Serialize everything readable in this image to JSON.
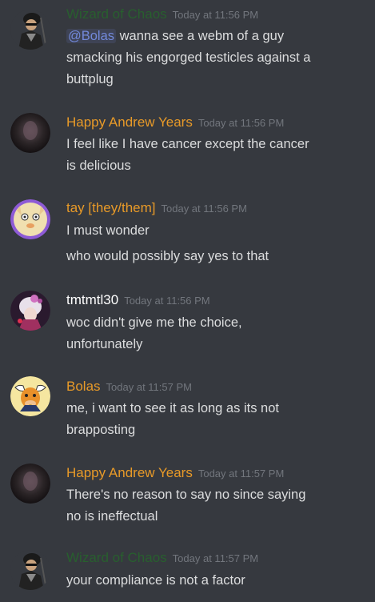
{
  "colors": {
    "background": "#36393f",
    "name_green": "#285f2e",
    "name_orange": "#e89a28",
    "name_white": "#ffffff",
    "timestamp": "#72767d",
    "text": "#dcddde",
    "mention": "#7289da"
  },
  "messages": [
    {
      "author": "Wizard of Chaos",
      "timestamp": "Today at 11:56 PM",
      "avatar": "wizard-avatar",
      "mention": "@Bolas",
      "lines": [
        "wanna see a webm of a guy",
        "smacking his engorged testicles against a",
        "buttplug"
      ]
    },
    {
      "author": "Happy Andrew Years",
      "timestamp": "Today at 11:56 PM",
      "avatar": "dark-face-avatar",
      "lines": [
        "I feel like I have cancer except the cancer",
        "is delicious"
      ]
    },
    {
      "author": "tay [they/them]",
      "timestamp": "Today at 11:56 PM",
      "avatar": "cartoon-cat-avatar",
      "lines": [
        "I must wonder",
        "who would possibly say yes to that"
      ]
    },
    {
      "author": "tmtmtl30",
      "timestamp": "Today at 11:56 PM",
      "avatar": "anime-girl-avatar",
      "lines": [
        "woc didn't give me the choice,",
        "unfortunately"
      ]
    },
    {
      "author": "Bolas",
      "timestamp": "Today at 11:57 PM",
      "avatar": "bull-avatar",
      "lines": [
        "me, i want to see it as long as its not",
        "brapposting"
      ]
    },
    {
      "author": "Happy Andrew Years",
      "timestamp": "Today at 11:57 PM",
      "avatar": "dark-face-avatar",
      "lines": [
        "There's no reason to say no since saying",
        "no is ineffectual"
      ]
    },
    {
      "author": "Wizard of Chaos",
      "timestamp": "Today at 11:57 PM",
      "avatar": "wizard-avatar",
      "lines": [
        "your compliance is not a factor"
      ]
    }
  ]
}
